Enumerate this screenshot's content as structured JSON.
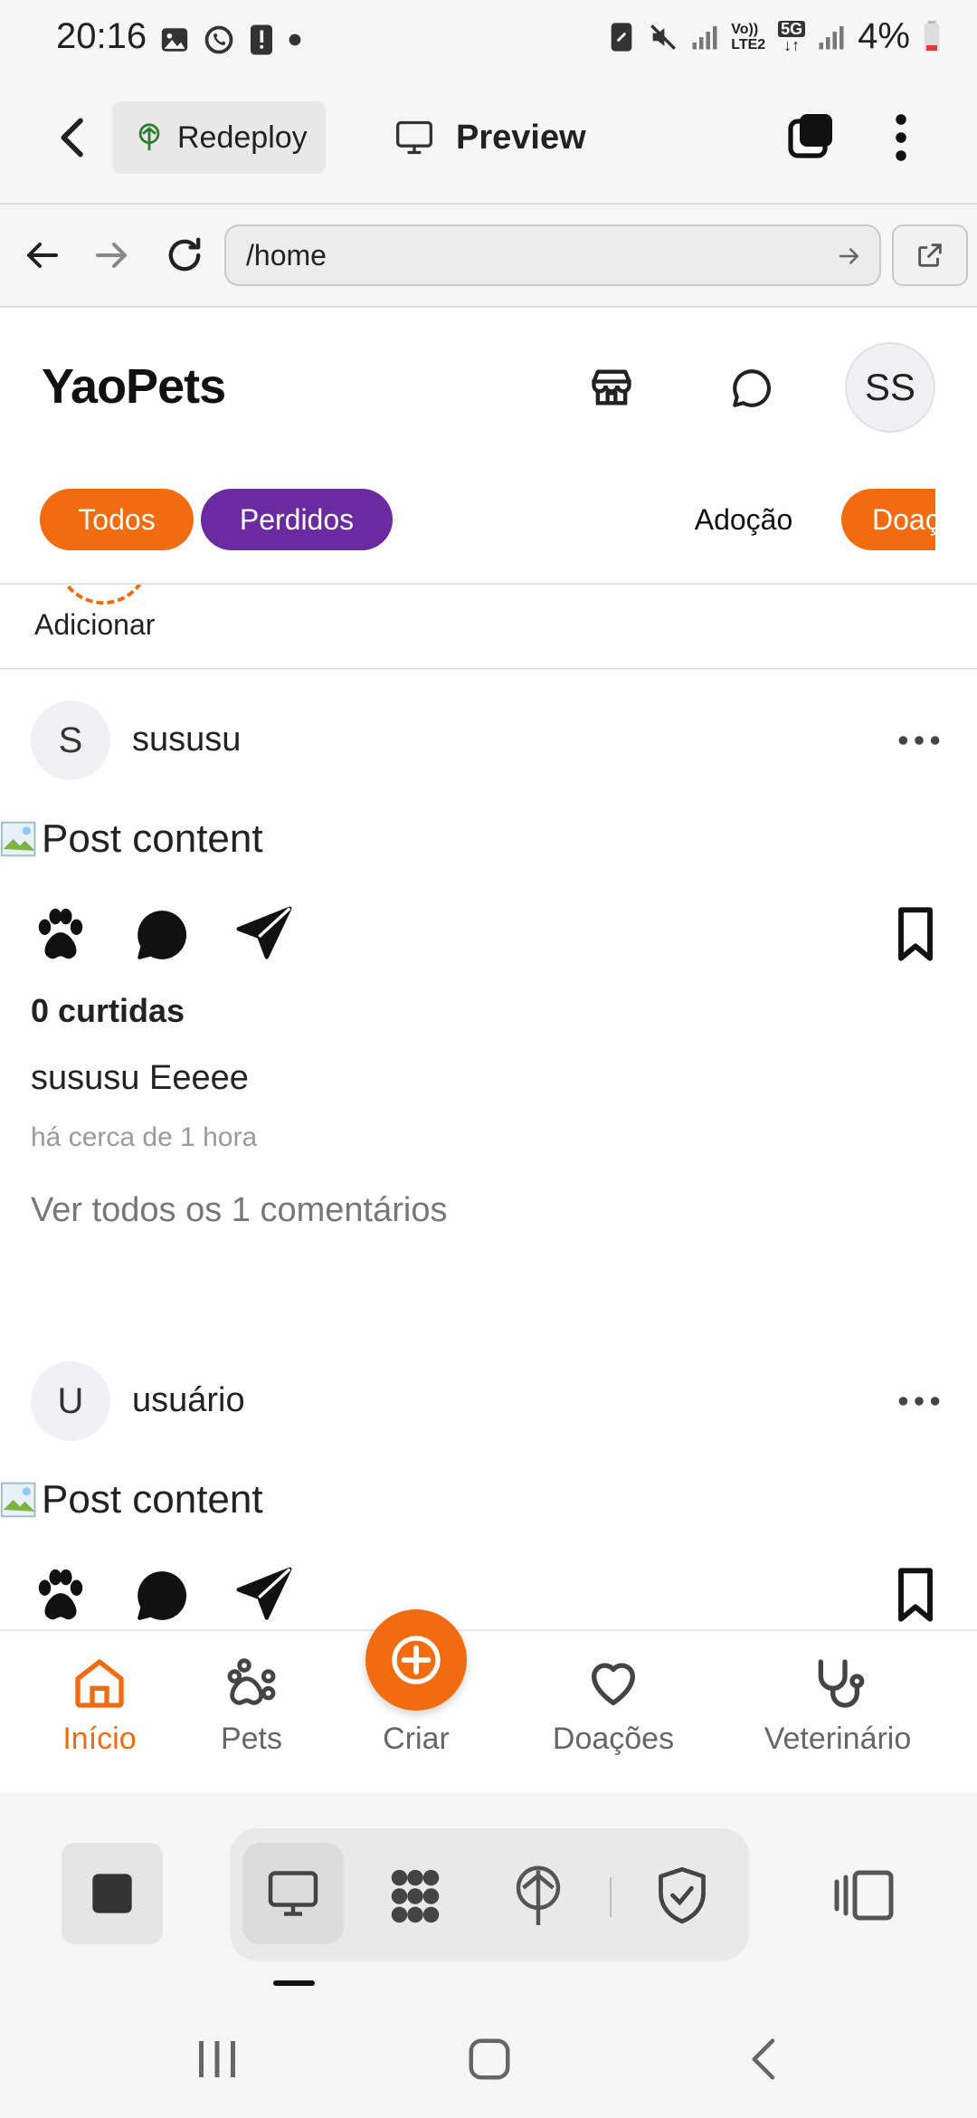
{
  "status_bar": {
    "time": "20:16",
    "battery": "4%",
    "network_label": "LTE2",
    "network_5g": "5G",
    "volte": "Vo))"
  },
  "app_bar": {
    "redeploy_label": "Redeploy",
    "preview_label": "Preview"
  },
  "browser": {
    "url": "/home"
  },
  "header": {
    "logo": "YaoPets",
    "avatar_initials": "SS"
  },
  "filters": [
    {
      "label": "Todos"
    },
    {
      "label": "Perdidos"
    },
    {
      "label": "Adoção"
    },
    {
      "label": "Doaç"
    }
  ],
  "stories": {
    "add_label": "Adicionar"
  },
  "posts": [
    {
      "avatar_letter": "S",
      "username": "sususu",
      "image_alt": "Post content",
      "likes": "0 curtidas",
      "caption_user": "sususu",
      "caption_text": "Eeeee",
      "time": "há cerca de 1 hora",
      "comments_link": "Ver todos os 1 comentários"
    },
    {
      "avatar_letter": "U",
      "username": "usuário",
      "image_alt": "Post content"
    }
  ],
  "bottom_nav": {
    "items": [
      {
        "label": "Início"
      },
      {
        "label": "Pets"
      },
      {
        "label": "Criar"
      },
      {
        "label": "Doações"
      },
      {
        "label": "Veterinário"
      }
    ]
  },
  "colors": {
    "accent": "#f26b0f",
    "purple": "#6b2aa0"
  }
}
